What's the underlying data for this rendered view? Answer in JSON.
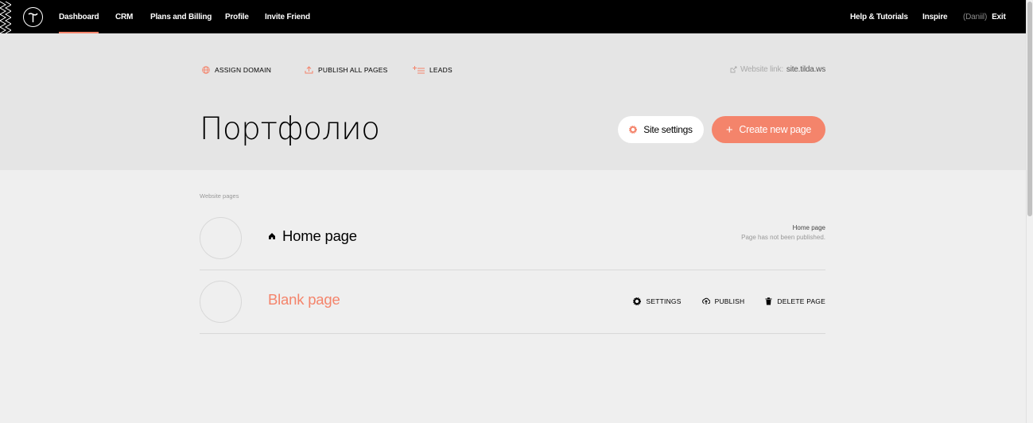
{
  "topbar": {
    "logo_icon": "tilda-logo-icon",
    "nav_left": [
      "Dashboard",
      "CRM",
      "Plans and Billing",
      "Profile",
      "Invite Friend"
    ],
    "active_nav": "Dashboard",
    "nav_right": {
      "help": "Help & Tutorials",
      "inspire": "Inspire",
      "user": "(Daniil)",
      "exit": "Exit"
    }
  },
  "project_actions": {
    "assign_domain": "ASSIGN DOMAIN",
    "publish_all": "PUBLISH ALL PAGES",
    "leads": "LEADS",
    "website_link_label": "Website link:",
    "website_link_url": "site.tilda.ws"
  },
  "project": {
    "title": "Портфолио",
    "site_settings_label": "Site settings",
    "create_page_label": "Create new page"
  },
  "pages": {
    "section_label": "Website pages",
    "items": [
      {
        "name": "Home page",
        "is_home": true,
        "meta_type": "Home page",
        "meta_status": "Page has not been published."
      },
      {
        "name": "Blank page",
        "is_home": false,
        "actions": [
          "SETTINGS",
          "PUBLISH",
          "DELETE PAGE"
        ]
      }
    ]
  },
  "colors": {
    "accent": "#f4846b",
    "topbar_bg": "#000000",
    "header_bg": "#e5e5e5",
    "page_bg": "#efefef"
  }
}
